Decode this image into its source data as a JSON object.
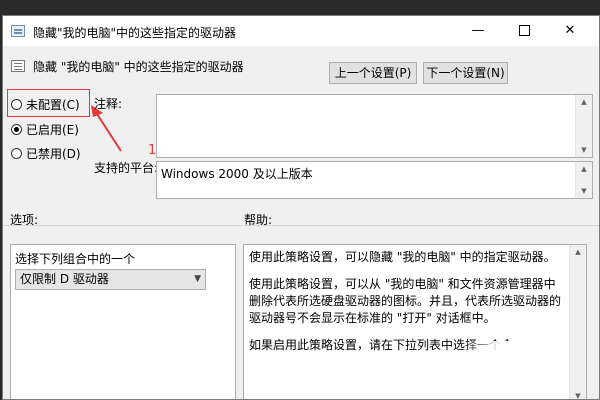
{
  "window": {
    "title": "隐藏\"我的电脑\"中的这些指定的驱动器",
    "minimize": "—",
    "close": "✕"
  },
  "header": {
    "policy_name": "隐藏 \"我的电脑\" 中的这些指定的驱动器",
    "prev_button": "上一个设置(P)",
    "next_button": "下一个设置(N)"
  },
  "state": {
    "options": [
      {
        "label": "未配置(C)",
        "checked": false
      },
      {
        "label": "已启用(E)",
        "checked": true
      },
      {
        "label": "已禁用(D)",
        "checked": false
      }
    ]
  },
  "annotation": {
    "number": "1",
    "color": "#e23a3a"
  },
  "comment": {
    "label": "注释:",
    "value": ""
  },
  "platform": {
    "label": "支持的平台:",
    "value": "Windows 2000 及以上版本"
  },
  "options_section": {
    "label": "选项:",
    "caption": "选择下列组合中的一个",
    "selected": "仅限制 D 驱动器"
  },
  "help_section": {
    "label": "帮助:",
    "paragraphs": [
      "使用此策略设置，可以隐藏 \"我的电脑\" 中的指定驱动器。",
      "使用此策略设置，可以从 \"我的电脑\" 和文件资源管理器中删除代表所选硬盘驱动器的图标。并且，代表所选驱动器的驱动器号不会显示在标准的 \"打开\" 对话框中。",
      "如果启用此策略设置，请在下拉列表中选择一个合。"
    ]
  }
}
